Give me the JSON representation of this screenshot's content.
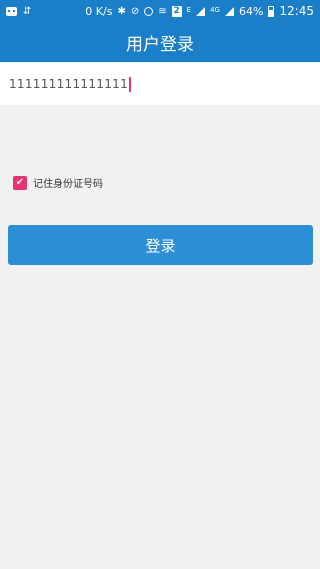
{
  "status_bar": {
    "net_speed": "0 K/s",
    "sim_slot": "2",
    "e_label": "E",
    "network_type": "4G",
    "battery_percent": "64%",
    "battery_level": 0.64,
    "time": "12:45"
  },
  "title": "用户登录",
  "id_input": {
    "value": "111111111111111"
  },
  "remember": {
    "checked": true,
    "label": "记住身份证号码"
  },
  "login_button": {
    "label": "登录"
  },
  "colors": {
    "primary": "#1a7ec8",
    "button": "#2c8fd4",
    "accent": "#e8336e",
    "background": "#f1f1f1"
  }
}
